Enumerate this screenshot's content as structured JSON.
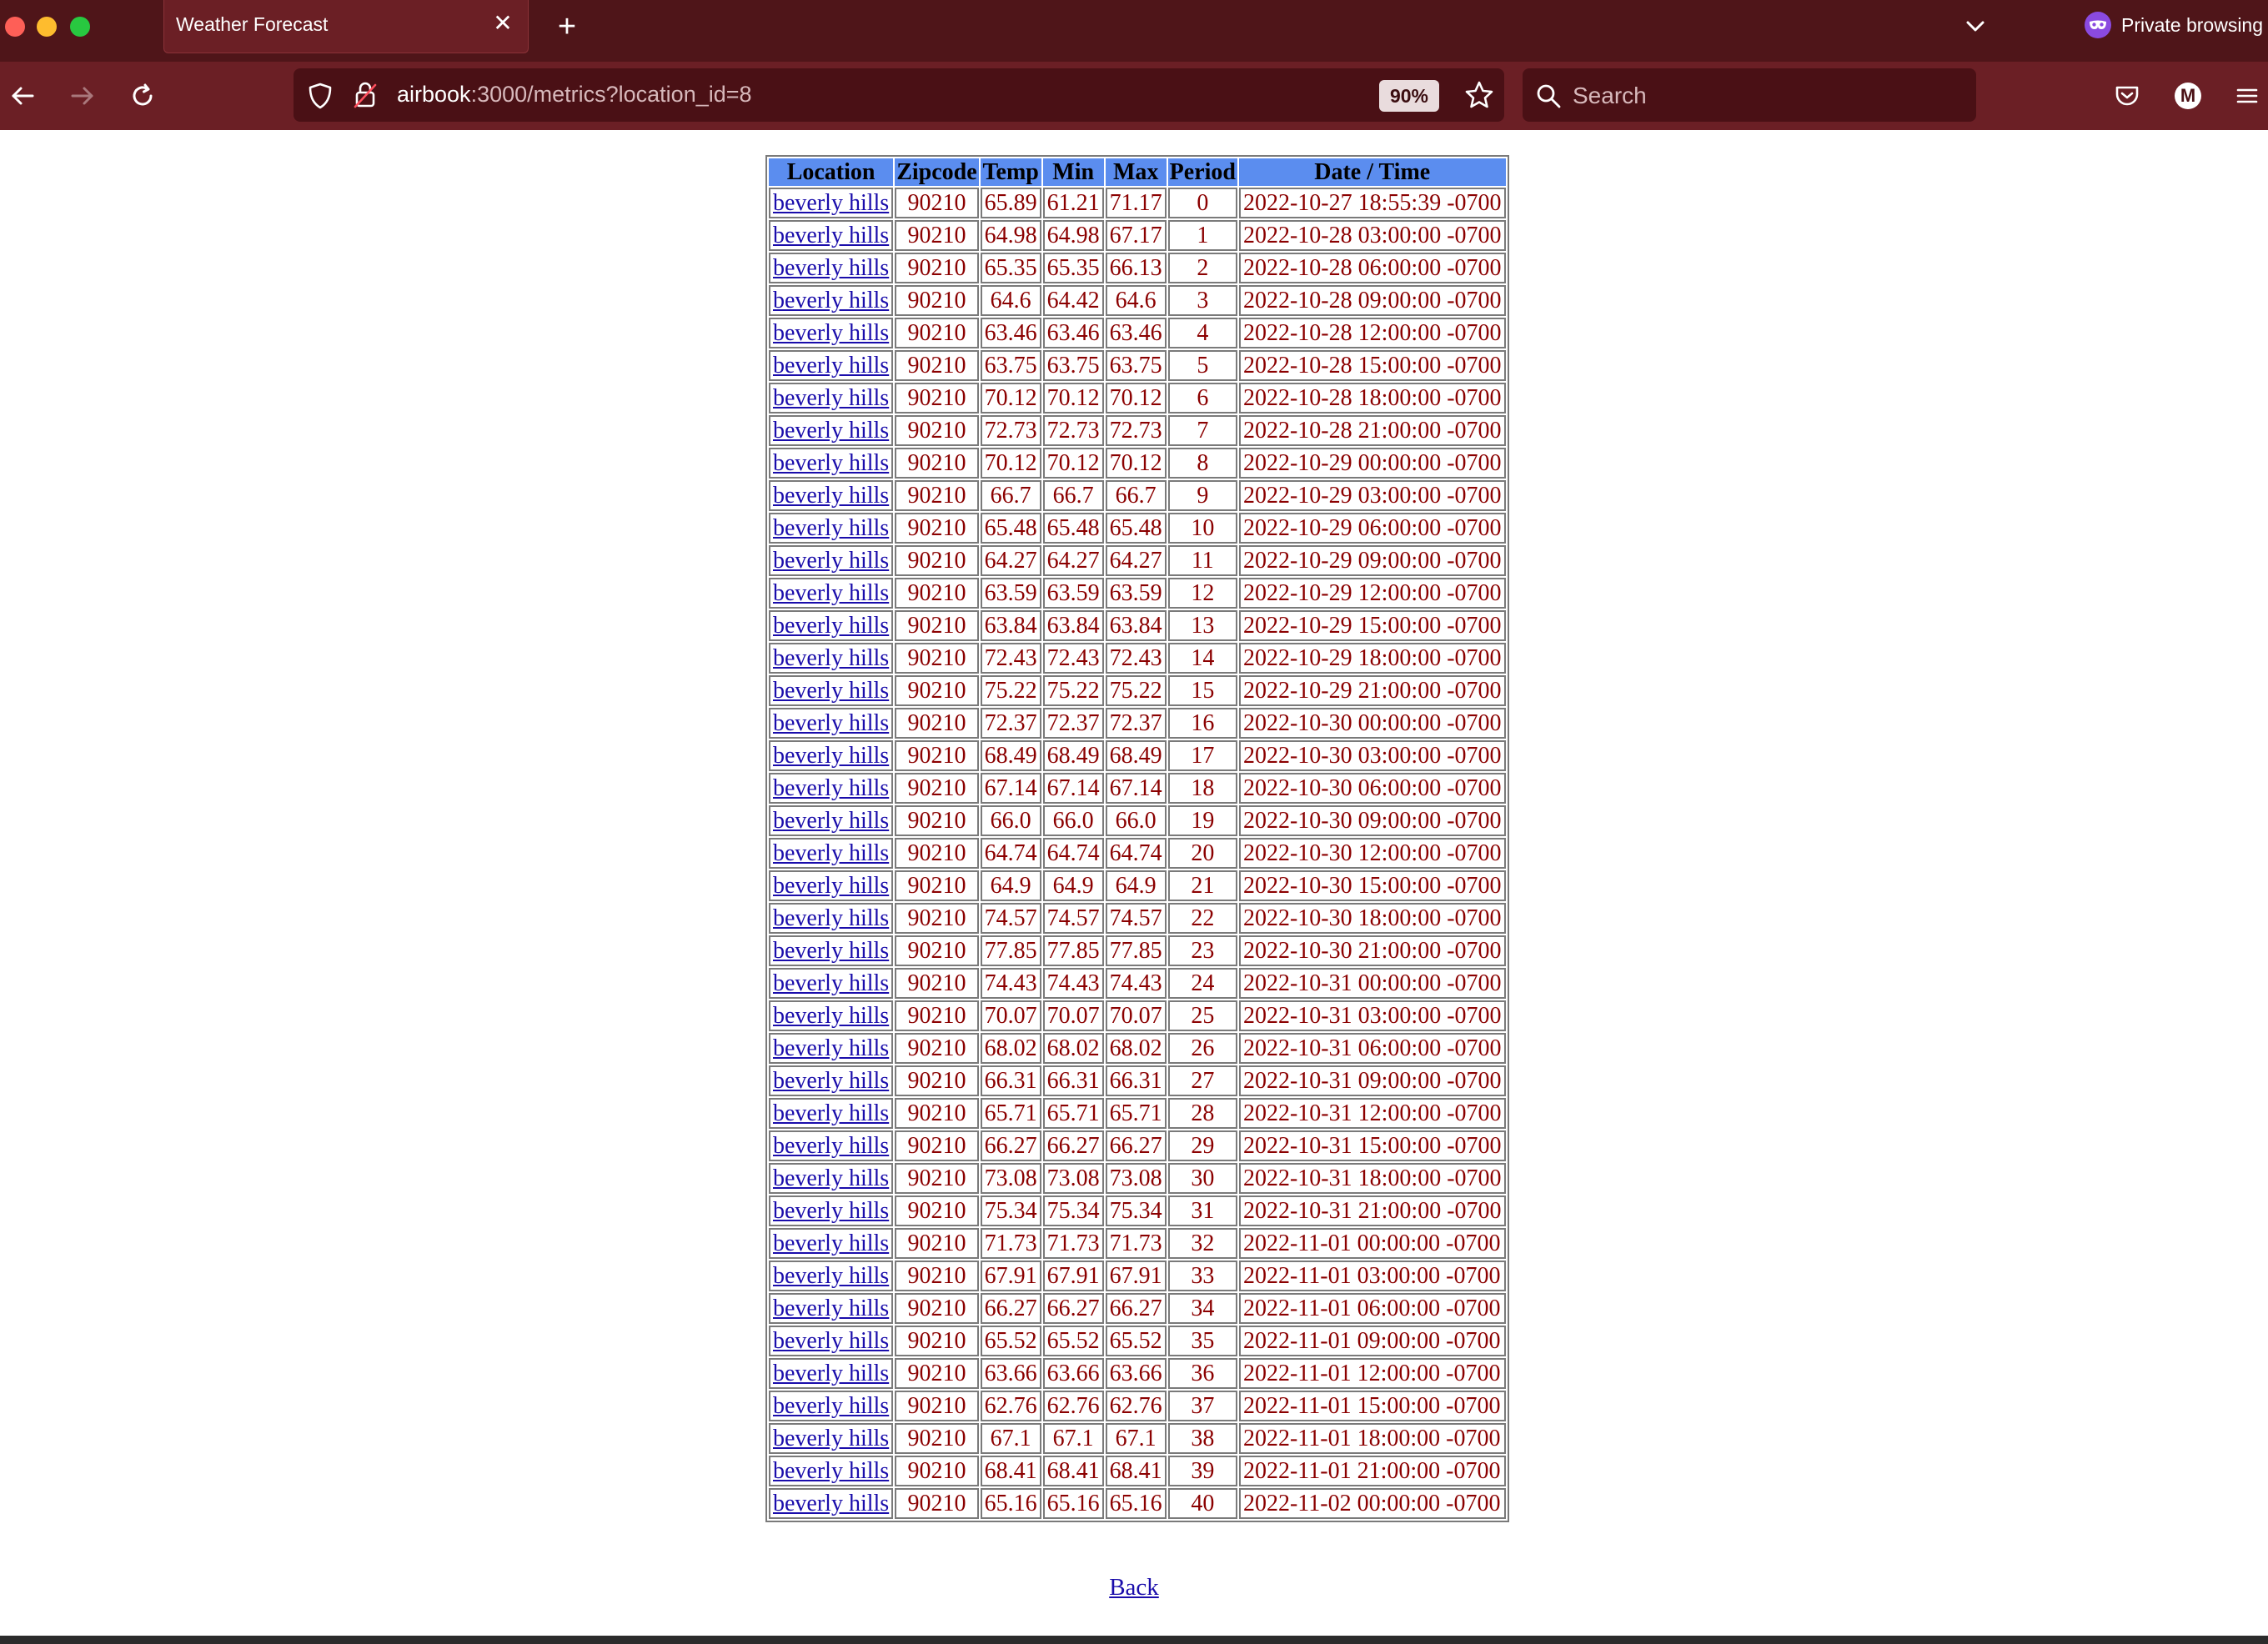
{
  "browser": {
    "tab_title": "Weather Forecast",
    "tab_close": "✕",
    "new_tab": "+",
    "private_label": "Private browsing",
    "url_host": "airbook",
    "url_rest": ":3000/metrics?location_id=8",
    "zoom": "90%",
    "search_placeholder": "Search",
    "account_initial": "M"
  },
  "table": {
    "headers": [
      "Location",
      "Zipcode",
      "Temp",
      "Min",
      "Max",
      "Period",
      "Date / Time"
    ],
    "rows": [
      [
        "beverly hills",
        "90210",
        "65.89",
        "61.21",
        "71.17",
        "0",
        "2022-10-27 18:55:39 -0700"
      ],
      [
        "beverly hills",
        "90210",
        "64.98",
        "64.98",
        "67.17",
        "1",
        "2022-10-28 03:00:00 -0700"
      ],
      [
        "beverly hills",
        "90210",
        "65.35",
        "65.35",
        "66.13",
        "2",
        "2022-10-28 06:00:00 -0700"
      ],
      [
        "beverly hills",
        "90210",
        "64.6",
        "64.42",
        "64.6",
        "3",
        "2022-10-28 09:00:00 -0700"
      ],
      [
        "beverly hills",
        "90210",
        "63.46",
        "63.46",
        "63.46",
        "4",
        "2022-10-28 12:00:00 -0700"
      ],
      [
        "beverly hills",
        "90210",
        "63.75",
        "63.75",
        "63.75",
        "5",
        "2022-10-28 15:00:00 -0700"
      ],
      [
        "beverly hills",
        "90210",
        "70.12",
        "70.12",
        "70.12",
        "6",
        "2022-10-28 18:00:00 -0700"
      ],
      [
        "beverly hills",
        "90210",
        "72.73",
        "72.73",
        "72.73",
        "7",
        "2022-10-28 21:00:00 -0700"
      ],
      [
        "beverly hills",
        "90210",
        "70.12",
        "70.12",
        "70.12",
        "8",
        "2022-10-29 00:00:00 -0700"
      ],
      [
        "beverly hills",
        "90210",
        "66.7",
        "66.7",
        "66.7",
        "9",
        "2022-10-29 03:00:00 -0700"
      ],
      [
        "beverly hills",
        "90210",
        "65.48",
        "65.48",
        "65.48",
        "10",
        "2022-10-29 06:00:00 -0700"
      ],
      [
        "beverly hills",
        "90210",
        "64.27",
        "64.27",
        "64.27",
        "11",
        "2022-10-29 09:00:00 -0700"
      ],
      [
        "beverly hills",
        "90210",
        "63.59",
        "63.59",
        "63.59",
        "12",
        "2022-10-29 12:00:00 -0700"
      ],
      [
        "beverly hills",
        "90210",
        "63.84",
        "63.84",
        "63.84",
        "13",
        "2022-10-29 15:00:00 -0700"
      ],
      [
        "beverly hills",
        "90210",
        "72.43",
        "72.43",
        "72.43",
        "14",
        "2022-10-29 18:00:00 -0700"
      ],
      [
        "beverly hills",
        "90210",
        "75.22",
        "75.22",
        "75.22",
        "15",
        "2022-10-29 21:00:00 -0700"
      ],
      [
        "beverly hills",
        "90210",
        "72.37",
        "72.37",
        "72.37",
        "16",
        "2022-10-30 00:00:00 -0700"
      ],
      [
        "beverly hills",
        "90210",
        "68.49",
        "68.49",
        "68.49",
        "17",
        "2022-10-30 03:00:00 -0700"
      ],
      [
        "beverly hills",
        "90210",
        "67.14",
        "67.14",
        "67.14",
        "18",
        "2022-10-30 06:00:00 -0700"
      ],
      [
        "beverly hills",
        "90210",
        "66.0",
        "66.0",
        "66.0",
        "19",
        "2022-10-30 09:00:00 -0700"
      ],
      [
        "beverly hills",
        "90210",
        "64.74",
        "64.74",
        "64.74",
        "20",
        "2022-10-30 12:00:00 -0700"
      ],
      [
        "beverly hills",
        "90210",
        "64.9",
        "64.9",
        "64.9",
        "21",
        "2022-10-30 15:00:00 -0700"
      ],
      [
        "beverly hills",
        "90210",
        "74.57",
        "74.57",
        "74.57",
        "22",
        "2022-10-30 18:00:00 -0700"
      ],
      [
        "beverly hills",
        "90210",
        "77.85",
        "77.85",
        "77.85",
        "23",
        "2022-10-30 21:00:00 -0700"
      ],
      [
        "beverly hills",
        "90210",
        "74.43",
        "74.43",
        "74.43",
        "24",
        "2022-10-31 00:00:00 -0700"
      ],
      [
        "beverly hills",
        "90210",
        "70.07",
        "70.07",
        "70.07",
        "25",
        "2022-10-31 03:00:00 -0700"
      ],
      [
        "beverly hills",
        "90210",
        "68.02",
        "68.02",
        "68.02",
        "26",
        "2022-10-31 06:00:00 -0700"
      ],
      [
        "beverly hills",
        "90210",
        "66.31",
        "66.31",
        "66.31",
        "27",
        "2022-10-31 09:00:00 -0700"
      ],
      [
        "beverly hills",
        "90210",
        "65.71",
        "65.71",
        "65.71",
        "28",
        "2022-10-31 12:00:00 -0700"
      ],
      [
        "beverly hills",
        "90210",
        "66.27",
        "66.27",
        "66.27",
        "29",
        "2022-10-31 15:00:00 -0700"
      ],
      [
        "beverly hills",
        "90210",
        "73.08",
        "73.08",
        "73.08",
        "30",
        "2022-10-31 18:00:00 -0700"
      ],
      [
        "beverly hills",
        "90210",
        "75.34",
        "75.34",
        "75.34",
        "31",
        "2022-10-31 21:00:00 -0700"
      ],
      [
        "beverly hills",
        "90210",
        "71.73",
        "71.73",
        "71.73",
        "32",
        "2022-11-01 00:00:00 -0700"
      ],
      [
        "beverly hills",
        "90210",
        "67.91",
        "67.91",
        "67.91",
        "33",
        "2022-11-01 03:00:00 -0700"
      ],
      [
        "beverly hills",
        "90210",
        "66.27",
        "66.27",
        "66.27",
        "34",
        "2022-11-01 06:00:00 -0700"
      ],
      [
        "beverly hills",
        "90210",
        "65.52",
        "65.52",
        "65.52",
        "35",
        "2022-11-01 09:00:00 -0700"
      ],
      [
        "beverly hills",
        "90210",
        "63.66",
        "63.66",
        "63.66",
        "36",
        "2022-11-01 12:00:00 -0700"
      ],
      [
        "beverly hills",
        "90210",
        "62.76",
        "62.76",
        "62.76",
        "37",
        "2022-11-01 15:00:00 -0700"
      ],
      [
        "beverly hills",
        "90210",
        "67.1",
        "67.1",
        "67.1",
        "38",
        "2022-11-01 18:00:00 -0700"
      ],
      [
        "beverly hills",
        "90210",
        "68.41",
        "68.41",
        "68.41",
        "39",
        "2022-11-01 21:00:00 -0700"
      ],
      [
        "beverly hills",
        "90210",
        "65.16",
        "65.16",
        "65.16",
        "40",
        "2022-11-02 00:00:00 -0700"
      ]
    ]
  },
  "back_label": "Back",
  "colors": {
    "chrome_dark": "#4f1519",
    "chrome_toolbar": "#6b1f25",
    "table_header": "#5b8def",
    "cell_text": "#8b0000",
    "link": "#1a0dab"
  },
  "icons": [
    "back-arrow-icon",
    "forward-arrow-icon",
    "reload-icon",
    "shield-icon",
    "lock-icon",
    "star-icon",
    "search-icon",
    "pocket-icon",
    "account-icon",
    "menu-icon",
    "chevron-down-icon",
    "private-mask-icon"
  ]
}
